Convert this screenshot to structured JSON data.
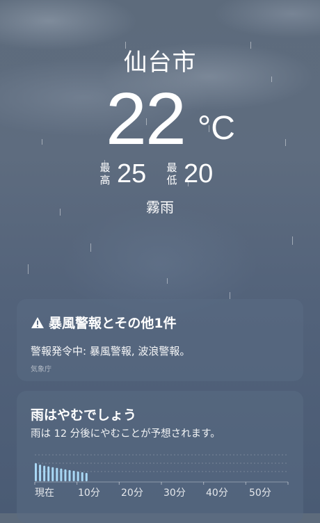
{
  "location": {
    "city": "仙台市"
  },
  "current": {
    "temperature": "22",
    "unit": "°C",
    "condition": "霧雨"
  },
  "high": {
    "label_line1": "最",
    "label_line2": "高",
    "value": "25"
  },
  "low": {
    "label_line1": "最",
    "label_line2": "低",
    "value": "20"
  },
  "alert": {
    "title": "暴風警報とその他1件",
    "body": "警報発令中: 暴風警報, 波浪警報。",
    "source": "気象庁",
    "icon": "warning-triangle-icon"
  },
  "precipitation": {
    "title": "雨はやむでしょう",
    "subtitle": "雨は 12 分後にやむことが予想されます。",
    "axis_labels": [
      "現在",
      "10分",
      "20分",
      "30分",
      "40分",
      "50分"
    ],
    "bar_color": "#a9d8f5"
  },
  "chart_data": {
    "type": "bar",
    "x": [
      0,
      1,
      2,
      3,
      4,
      5,
      6,
      7,
      8,
      9,
      10,
      11,
      12
    ],
    "values": [
      1.0,
      0.92,
      0.86,
      0.82,
      0.78,
      0.74,
      0.7,
      0.66,
      0.62,
      0.58,
      0.54,
      0.5,
      0.46
    ],
    "xlabel": "",
    "ylabel": "",
    "tick_labels": [
      "現在",
      "10分",
      "20分",
      "30分",
      "40分",
      "50分"
    ],
    "xlim": [
      0,
      60
    ]
  }
}
